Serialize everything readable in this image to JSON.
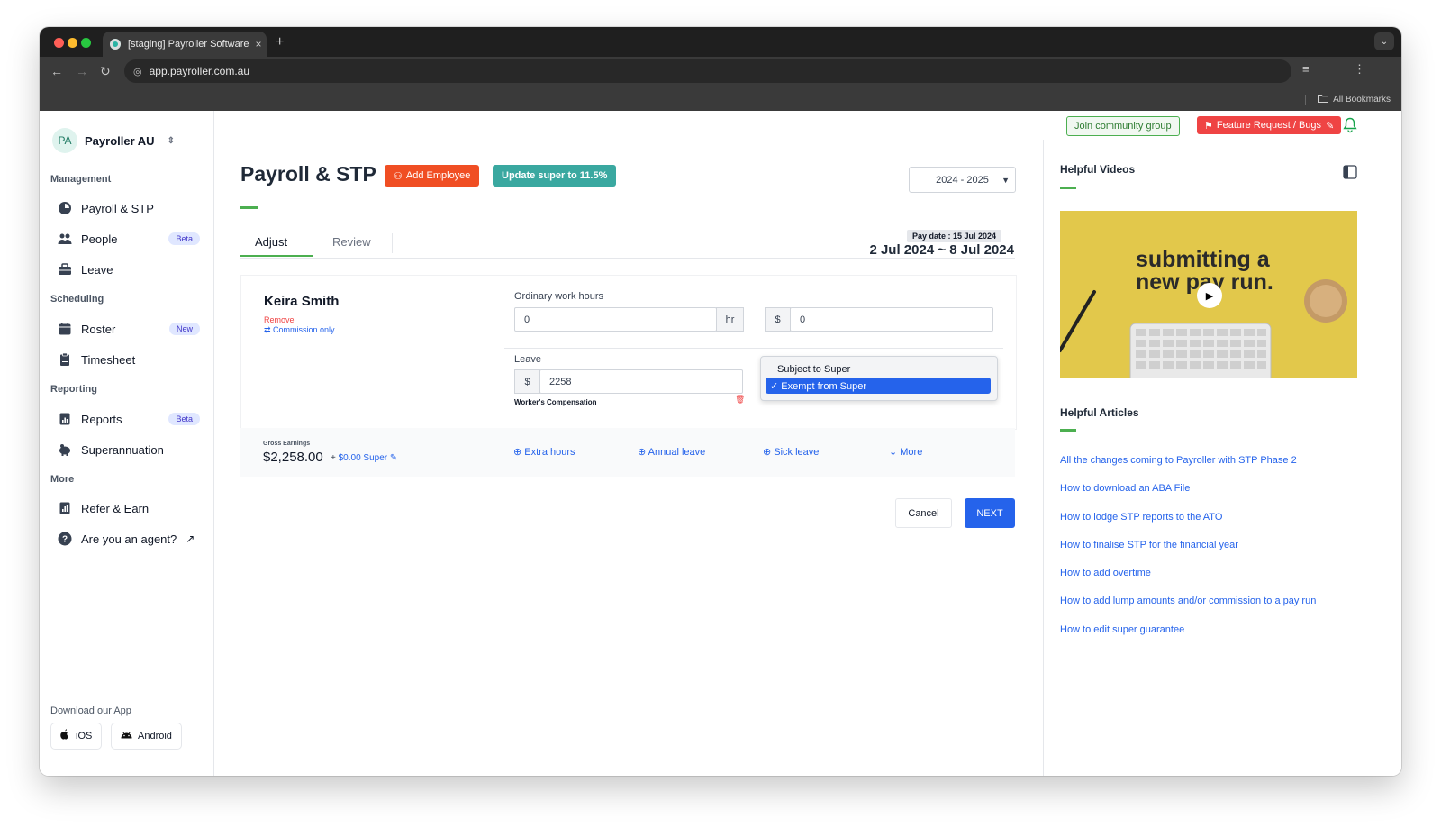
{
  "browser": {
    "tab_title": "[staging] Payroller Software",
    "tab_close": "×",
    "new_tab": "+",
    "url": "app.payroller.com.au",
    "bookmarks_label": "All Bookmarks"
  },
  "org": {
    "initials": "PA",
    "name": "Payroller AU"
  },
  "sidebar": {
    "management_label": "Management",
    "scheduling_label": "Scheduling",
    "reporting_label": "Reporting",
    "more_label": "More",
    "items": [
      {
        "label": "Payroll & STP",
        "icon": "payroll-icon"
      },
      {
        "label": "People",
        "icon": "people-icon",
        "badge": "Beta"
      },
      {
        "label": "Leave",
        "icon": "briefcase-icon"
      },
      {
        "label": "Roster",
        "icon": "calendar-icon",
        "badge": "New"
      },
      {
        "label": "Timesheet",
        "icon": "clipboard-icon"
      },
      {
        "label": "Reports",
        "icon": "reports-icon",
        "badge": "Beta"
      },
      {
        "label": "Superannuation",
        "icon": "piggy-bank-icon"
      },
      {
        "label": "Refer & Earn",
        "icon": "refer-icon"
      },
      {
        "label": "Are you an agent?",
        "icon": "help-icon"
      }
    ],
    "download_label": "Download our App",
    "ios_label": "iOS",
    "android_label": "Android"
  },
  "topbar": {
    "community": "Join community group",
    "feature": "Feature Request / Bugs"
  },
  "header": {
    "title": "Payroll & STP",
    "add_employee": "Add Employee",
    "update_super": "Update super to 11.5%",
    "year": "2024 - 2025"
  },
  "tabs": {
    "adjust": "Adjust",
    "review": "Review"
  },
  "period": {
    "pay_date": "Pay date : 15 Jul 2024",
    "range": "2 Jul 2024 ~ 8 Jul 2024"
  },
  "employee": {
    "name": "Keira Smith",
    "remove": "Remove",
    "commission": "⇄ Commission only",
    "ordinary_label": "Ordinary work hours",
    "hours_value": "0",
    "hr_unit": "hr",
    "currency": "$",
    "amount_value": "0",
    "leave_label": "Leave",
    "leave_value": "2258",
    "leave_type": "Worker's Compensation",
    "super_options": [
      "Subject to Super",
      "✓ Exempt from Super"
    ]
  },
  "summary": {
    "gross_label": "Gross Earnings",
    "gross_value": "$2,258.00",
    "plus": "+",
    "super": "$0.00 Super",
    "extra_hours": "⊕ Extra hours",
    "annual_leave": "⊕ Annual leave",
    "sick_leave": "⊕ Sick leave",
    "more": "⌄ More"
  },
  "actions": {
    "cancel": "Cancel",
    "next": "NEXT"
  },
  "right": {
    "videos_title": "Helpful Videos",
    "video_text": "submitting a new pay run.",
    "articles_title": "Helpful Articles",
    "articles": [
      "All the changes coming to Payroller with STP Phase 2",
      "How to download an ABA File",
      "How to lodge STP reports to the ATO",
      "How to finalise STP for the financial year",
      "How to add overtime",
      "How to add lump amounts and/or commission to a pay run",
      "How to edit super guarantee"
    ]
  }
}
